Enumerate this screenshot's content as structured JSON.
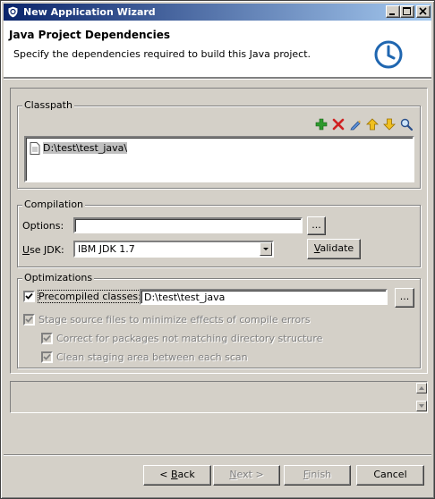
{
  "window": {
    "title": "New Application Wizard",
    "buttons": [
      "minimize-icon",
      "maximize-icon",
      "close-icon"
    ]
  },
  "header": {
    "title": "Java Project Dependencies",
    "description": "Specify the dependencies required to build this Java project.",
    "logo": "clock-icon"
  },
  "classpath": {
    "label": "Classpath",
    "toolbar_icons": [
      "add-icon",
      "remove-icon",
      "edit-icon",
      "move-up-icon",
      "move-down-icon",
      "search-icon"
    ],
    "items": [
      {
        "icon": "file-icon",
        "path": "D:\\test\\test_java\\"
      }
    ]
  },
  "compilation": {
    "label": "Compilation",
    "options_label": "Options:",
    "options_value": "",
    "browse_label": "...",
    "jdk_label_u": "U",
    "jdk_label_rest": "se JDK:",
    "jdk_value": "IBM JDK 1.7",
    "validate_u": "V",
    "validate_rest": "alidate"
  },
  "optimizations": {
    "label": "Optimizations",
    "precompiled_label": "Precompiled classes:",
    "precompiled_checked": true,
    "precompiled_path": "D:\\test\\test_java",
    "browse_label": "...",
    "stage_label": "Stage source files to minimize effects of compile errors",
    "stage_checked": true,
    "correct_label": "Correct for packages not matching directory structure",
    "correct_checked": true,
    "clean_label": "Clean staging area between each scan",
    "clean_checked": true
  },
  "footer": {
    "back_prefix": "< ",
    "back_u": "B",
    "back_rest": "ack",
    "next_u": "N",
    "next_rest": "ext >",
    "finish_u": "F",
    "finish_rest": "inish",
    "cancel": "Cancel"
  },
  "colors": {
    "title_gradient_start": "#0a246a",
    "title_gradient_end": "#a6caf0",
    "dialog_background": "#d4d0c8",
    "selection": "#c0c0c0",
    "add_icon": "#2e9a2e",
    "remove_icon": "#d02020",
    "arrow_icons": "#e8b000"
  }
}
